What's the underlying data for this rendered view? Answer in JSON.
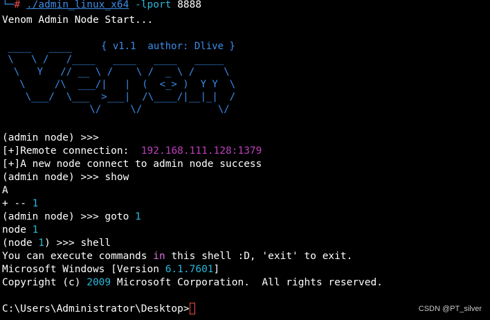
{
  "prompt": {
    "corner": "└─",
    "hash": "#",
    "binary": "./admin_linux_x64",
    "flag": "-lport",
    "port": "8888"
  },
  "start_msg": "Venom Admin Node Start...",
  "banner": {
    "version_line": "{ v1.1  author: Dlive }",
    "art": [
      " ____   ____ ",
      " \\   \\ /   /____   ____   ____   _____",
      "  \\   Y   // __ \\ /    \\ /  _ \\ /     \\",
      "   \\     /\\  ___/|   |  (  <_> )  Y Y  \\",
      "    \\___/  \\___  >___|  /\\____/|__|_|  /",
      "               \\/     \\/             \\/"
    ]
  },
  "session": {
    "admin_prompt": "(admin node) >>>",
    "remote_label": "[+]Remote connection:",
    "remote_addr": "192.168.111.128:1379",
    "connect_msg": "[+]A new node connect to admin node success",
    "show_cmd": "show",
    "tree_root": "A",
    "tree_prefix": "+ -- ",
    "tree_node": "1",
    "goto_cmd": "goto",
    "goto_arg": "1",
    "node_label": "node",
    "node_num": "1",
    "node_prompt_open": "(node ",
    "node_prompt_num": "1",
    "node_prompt_close": ") >>>",
    "shell_cmd": "shell",
    "shell_msg_a": "You can execute commands ",
    "shell_msg_in": "in",
    "shell_msg_b": " this shell :D, 'exit' to exit.",
    "win_a": "Microsoft Windows [Version ",
    "win_ver": "6.1.7601",
    "win_b": "]",
    "copy_a": "Copyright (c) ",
    "copy_year": "2009",
    "copy_b": " Microsoft Corporation.  All rights reserved.",
    "cwd_prompt": "C:\\Users\\Administrator\\Desktop>"
  },
  "watermark": "CSDN @PT_silver",
  "colors": {
    "background": "#000000",
    "text": "#ffffff",
    "banner_blue": "#3b8eea",
    "ip_purple": "#bc3fbc",
    "number_cyan": "#29b8db",
    "cursor_red": "#f14c4c"
  }
}
